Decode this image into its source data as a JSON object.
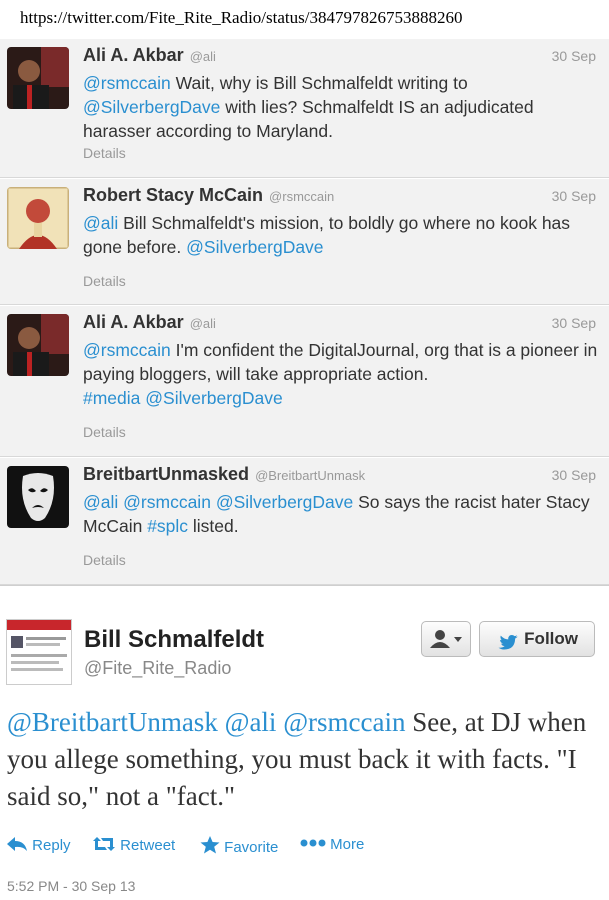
{
  "url": "https://twitter.com/Fite_Rite_Radio/status/384797826753888260",
  "tweets": [
    {
      "name": "Ali A. Akbar",
      "handle": "@ali",
      "date": "30 Sep",
      "mention1": "@rsmccain",
      "text1": " Wait, why is Bill Schmalfeldt writing to",
      "mention2": "@SilverbergDave",
      "text2": " with lies? Schmalfeldt IS an adjudicated harasser according to Maryland.",
      "details": "Details"
    },
    {
      "name": "Robert Stacy McCain",
      "handle": "@rsmccain",
      "date": "30 Sep",
      "mention1": "@ali",
      "text1": " Bill Schmalfeldt's mission, to boldly go where no kook has gone before. ",
      "mention2": "@SilverbergDave",
      "details": "Details"
    },
    {
      "name": "Ali A. Akbar",
      "handle": "@ali",
      "date": "30 Sep",
      "mention1": "@rsmccain",
      "text1": " I'm confident the DigitalJournal, org that is a pioneer in paying bloggers, will take appropriate action.",
      "hashtag": "#media",
      "mention2": "@SilverbergDave",
      "details": "Details"
    },
    {
      "name": "BreitbartUnmasked",
      "handle": "@BreitbartUnmask",
      "date": "30 Sep",
      "mention1": "@ali",
      "mention2": "@rsmccain",
      "mention3": "@SilverbergDave",
      "text1": " So says the racist hater Stacy McCain ",
      "hashtag": "#splc",
      "text2": " listed.",
      "details": "Details"
    }
  ],
  "main_tweet": {
    "name": "Bill Schmalfeldt",
    "handle": "@Fite_Rite_Radio",
    "follow_label": "Follow",
    "mention1": "@BreitbartUnmask",
    "mention2": "@ali",
    "mention3": "@rsmccain",
    "text": " See, at DJ when you allege something, you must back it with facts. \"I said so,\" not a \"fact.\"",
    "actions": {
      "reply": "Reply",
      "retweet": "Retweet",
      "favorite": "Favorite",
      "more": "More"
    },
    "timestamp": "5:52 PM - 30 Sep 13"
  },
  "colors": {
    "link": "#2a8fd0",
    "feed_bg": "#f2f2f2"
  },
  "icons": [
    "user-dropdown-icon",
    "twitter-bird-icon",
    "reply-icon",
    "retweet-icon",
    "favorite-star-icon",
    "more-dots-icon"
  ]
}
